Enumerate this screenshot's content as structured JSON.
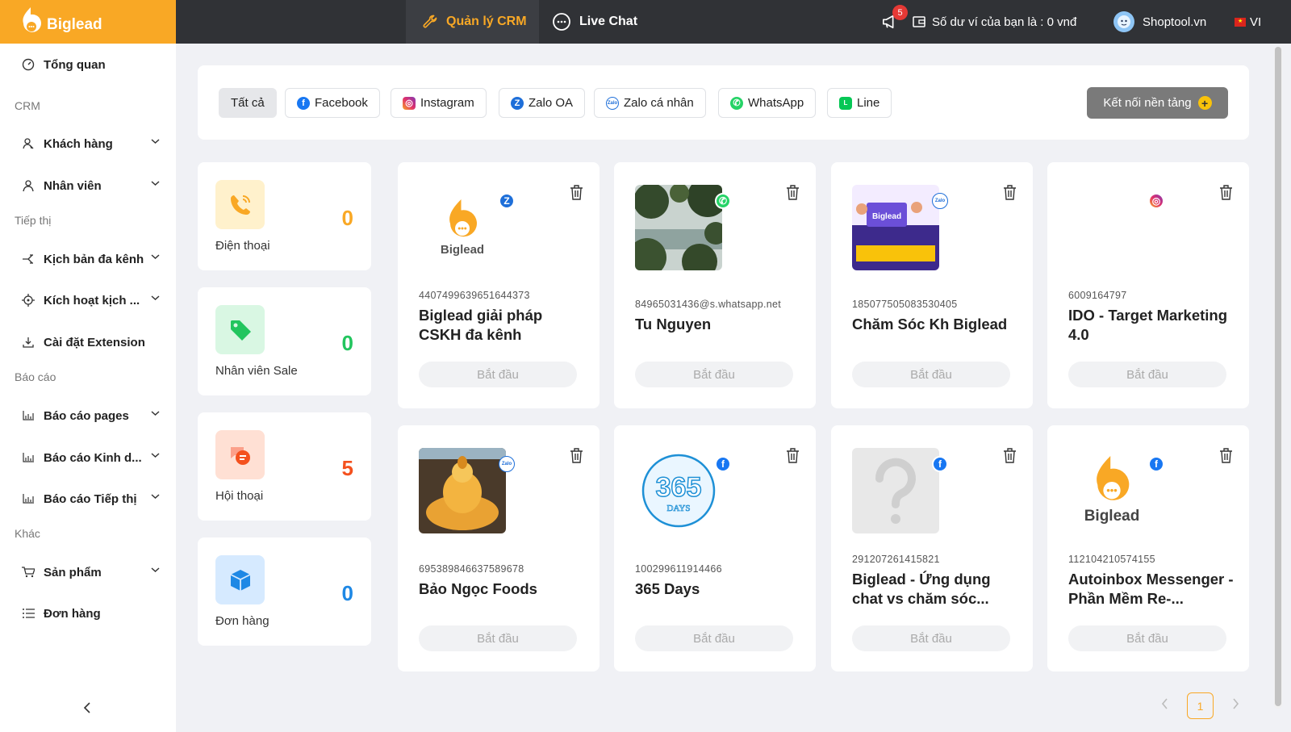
{
  "brand": {
    "name": "Biglead"
  },
  "topnav": {
    "crm_tab": "Quản lý CRM",
    "chat_tab": "Live Chat",
    "notification_count": "5",
    "wallet_text": "Số dư ví của bạn là :  0 vnđ",
    "shop_name": "Shoptool.vn",
    "lang": "VI"
  },
  "sidebar": {
    "overview": "Tổng quan",
    "section_crm": "CRM",
    "customers": "Khách hàng",
    "staff": "Nhân viên",
    "section_marketing": "Tiếp thị",
    "multichannel": "Kịch bản đa kênh",
    "activate": "Kích hoạt kịch ...",
    "extension": "Cài đặt Extension",
    "section_reports": "Báo cáo",
    "report_pages": "Báo cáo pages",
    "report_business": "Báo cáo Kinh d...",
    "report_marketing": "Báo cáo Tiếp thị",
    "section_other": "Khác",
    "products": "Sản phẩm",
    "orders": "Đơn hàng"
  },
  "filters": {
    "all": "Tất cả",
    "facebook": "Facebook",
    "instagram": "Instagram",
    "zalo_oa": "Zalo OA",
    "zalo_personal": "Zalo cá nhân",
    "whatsapp": "WhatsApp",
    "line": "Line",
    "connect": "Kết nối nền tảng"
  },
  "stats": [
    {
      "label": "Điện thoại",
      "value": "0",
      "color": "#f9a825"
    },
    {
      "label": "Nhân viên Sale",
      "value": "0",
      "color": "#22c55e"
    },
    {
      "label": "Hội thoại",
      "value": "5",
      "color": "#f4511e"
    },
    {
      "label": "Đơn hàng",
      "value": "0",
      "color": "#1e88e5"
    }
  ],
  "pages": [
    {
      "id": "4407499639651644373",
      "name": "Biglead giải pháp CSKH đa kênh",
      "platform": "zalo-oa",
      "avatar_text": "Biglead"
    },
    {
      "id": "84965031436@s.whatsapp.net",
      "name": "Tu Nguyen",
      "platform": "whatsapp"
    },
    {
      "id": "185077505083530405",
      "name": "Chăm Sóc Kh Biglead",
      "platform": "zalo",
      "avatar_text": "Biglead",
      "zalo_badge": "Zalo"
    },
    {
      "id": "6009164797",
      "name": "IDO - Target Marketing 4.0",
      "platform": "instagram"
    },
    {
      "id": "695389846637589678",
      "name": "Bảo Ngọc Foods",
      "platform": "zalo",
      "zalo_badge": "Zalo"
    },
    {
      "id": "100299611914466",
      "name": "365 Days",
      "platform": "facebook",
      "avatar_text": "365",
      "avatar_subtext": "DAYS"
    },
    {
      "id": "291207261415821",
      "name": "Biglead - Ứng dụng chat vs chăm sóc...",
      "platform": "facebook"
    },
    {
      "id": "112104210574155",
      "name": "Autoinbox Messenger - Phần Mềm Re-...",
      "platform": "facebook",
      "avatar_text": "Biglead"
    }
  ],
  "start_label": "Bắt đầu",
  "pagination": {
    "current": "1"
  }
}
